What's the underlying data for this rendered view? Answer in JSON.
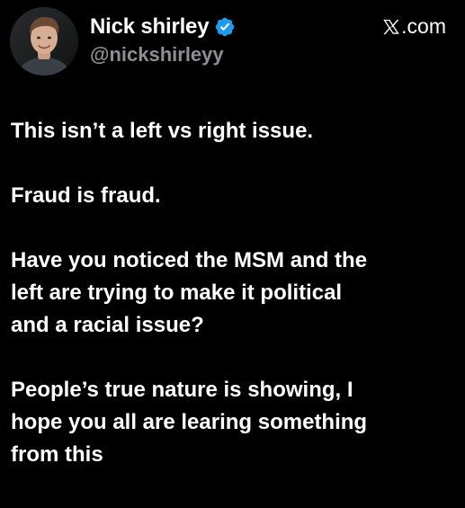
{
  "post": {
    "author": {
      "display_name": "Nick shirley",
      "handle": "@nickshirleyy",
      "verified": true,
      "avatar": "profile-photo"
    },
    "source_label": ".com",
    "source_icon": "x-logo-icon",
    "paragraphs": [
      "This isn’t a left vs right issue.",
      "Fraud is fraud.",
      "Have you noticed the MSM and the\nleft are trying to make it political\nand a racial issue?",
      "People’s true nature is showing, I\nhope you all are learing something\nfrom this"
    ]
  },
  "colors": {
    "background": "#000000",
    "text": "#ffffff",
    "handle": "#8b8f94",
    "verified_badge": "#1d9bf0"
  },
  "icons": [
    "verified-badge-icon",
    "x-logo-icon"
  ]
}
